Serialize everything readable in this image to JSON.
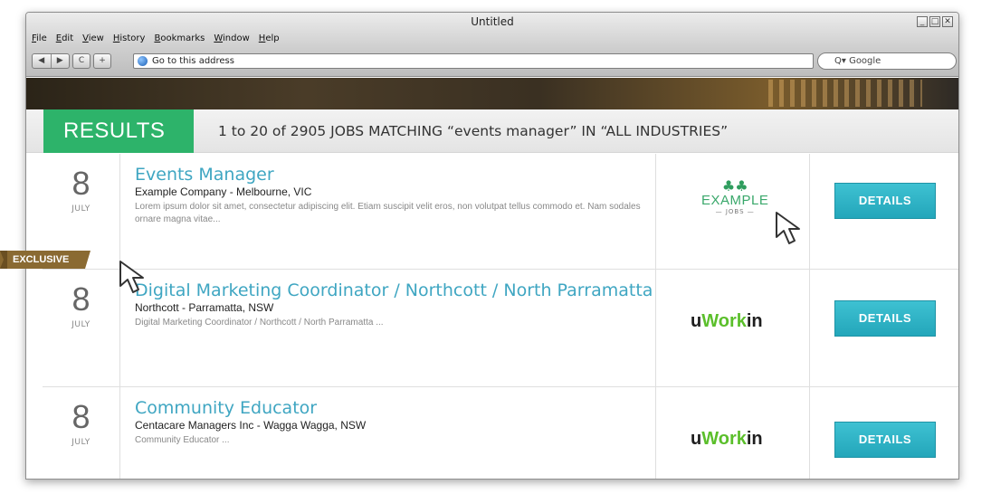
{
  "window": {
    "title": "Untitled",
    "controls": [
      "_",
      "□",
      "✕"
    ]
  },
  "menu": [
    "File",
    "Edit",
    "View",
    "History",
    "Bookmarks",
    "Window",
    "Help"
  ],
  "toolbar": {
    "back": "◀",
    "forward": "▶",
    "reload": "C",
    "add": "+",
    "address_placeholder": "Go to this address",
    "search_placeholder": "Q▾ Google"
  },
  "results": {
    "tag": "RESULTS",
    "summary": "1 to 20 of 2905 JOBS MATCHING “events manager” IN “ALL INDUSTRIES”"
  },
  "jobs": [
    {
      "day": "8",
      "month": "JULY",
      "title": "Events Manager",
      "company": "Example Company - Melbourne, VIC",
      "description": "Lorem ipsum dolor sit amet, consectetur adipiscing elit. Etiam suscipit velit eros, non volutpat tellus commodo et. Nam sodales ornare magna vitae...",
      "logo": {
        "word": "EXAMPLE",
        "sub": "JOBS"
      },
      "button": "DETAILS",
      "badge": "EXCLUSIVE"
    },
    {
      "day": "8",
      "month": "JULY",
      "title": "Digital Marketing Coordinator / Northcott / North Parramatta",
      "company": "Northcott - Parramatta, NSW",
      "description": "Digital Marketing Coordinator / Northcott / North Parramatta ...",
      "logo": {
        "u": "u",
        "work": "Work",
        "in": "in"
      },
      "button": "DETAILS"
    },
    {
      "day": "8",
      "month": "JULY",
      "title": "Community Educator",
      "company": "Centacare Managers Inc - Wagga Wagga, NSW",
      "description": "Community Educator ...",
      "logo": {
        "u": "u",
        "work": "Work",
        "in": "in"
      },
      "button": "DETAILS"
    }
  ]
}
